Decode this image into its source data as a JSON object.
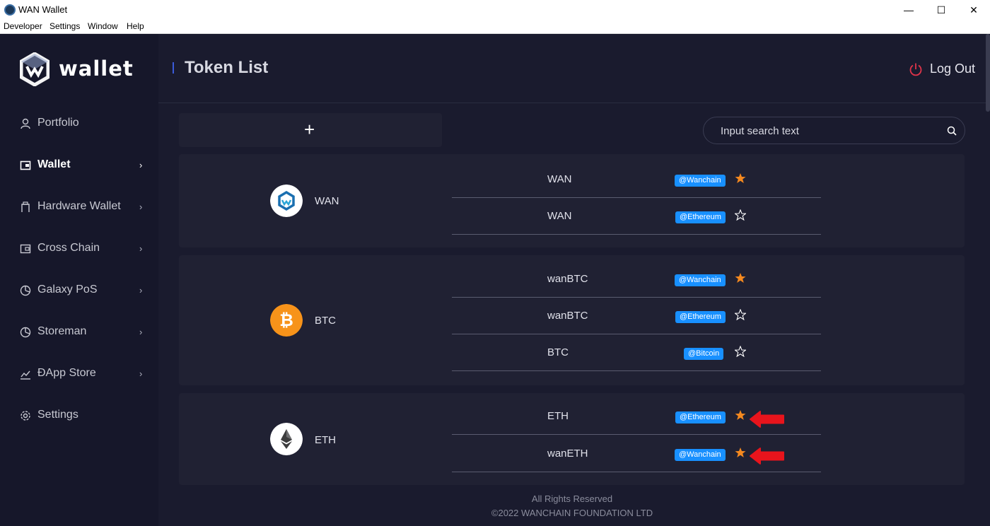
{
  "window": {
    "title": "WAN Wallet",
    "minimize_glyph": "—",
    "maximize_glyph": "☐",
    "close_glyph": "✕"
  },
  "menubar": {
    "items": [
      "Developer",
      "Settings",
      "Window",
      "Help"
    ]
  },
  "sidebar": {
    "logo_text": "wallet",
    "items": [
      {
        "label": "Portfolio",
        "icon": "user-icon",
        "has_chevron": false,
        "active": false
      },
      {
        "label": "Wallet",
        "icon": "wallet-icon",
        "has_chevron": true,
        "active": true
      },
      {
        "label": "Hardware Wallet",
        "icon": "hardware-icon",
        "has_chevron": true,
        "active": false
      },
      {
        "label": "Cross Chain",
        "icon": "cross-chain-icon",
        "has_chevron": true,
        "active": false
      },
      {
        "label": "Galaxy PoS",
        "icon": "pie-chart-icon",
        "has_chevron": true,
        "active": false
      },
      {
        "label": "Storeman",
        "icon": "pie-chart-icon",
        "has_chevron": true,
        "active": false
      },
      {
        "label": "ĐApp Store",
        "icon": "line-chart-icon",
        "has_chevron": true,
        "active": false
      },
      {
        "label": "Settings",
        "icon": "gear-icon",
        "has_chevron": false,
        "active": false
      }
    ],
    "chevron_glyph": "›",
    "collapse_glyph": "‹"
  },
  "header": {
    "title": "Token List",
    "logout_label": "Log Out"
  },
  "toolbar": {
    "add_glyph": "+",
    "search_placeholder": "Input search text"
  },
  "token_groups": [
    {
      "name": "WAN",
      "logo": "wan-logo-icon",
      "tokens": [
        {
          "symbol": "WAN",
          "chain": "@Wanchain",
          "starred": true,
          "arrow": false
        },
        {
          "symbol": "WAN",
          "chain": "@Ethereum",
          "starred": false,
          "arrow": false
        }
      ]
    },
    {
      "name": "BTC",
      "logo": "btc-logo-icon",
      "tokens": [
        {
          "symbol": "wanBTC",
          "chain": "@Wanchain",
          "starred": true,
          "arrow": false
        },
        {
          "symbol": "wanBTC",
          "chain": "@Ethereum",
          "starred": false,
          "arrow": false
        },
        {
          "symbol": "BTC",
          "chain": "@Bitcoin",
          "starred": false,
          "arrow": false
        }
      ]
    },
    {
      "name": "ETH",
      "logo": "eth-logo-icon",
      "tokens": [
        {
          "symbol": "ETH",
          "chain": "@Ethereum",
          "starred": true,
          "arrow": true
        },
        {
          "symbol": "wanETH",
          "chain": "@Wanchain",
          "starred": true,
          "arrow": true
        }
      ]
    }
  ],
  "footer": {
    "line1": "All Rights Reserved",
    "line2": "©2022 WANCHAIN FOUNDATION LTD"
  },
  "colors": {
    "accent_blue": "#1890ff",
    "star_orange": "#f5891f",
    "logout_red": "#e0344a",
    "annotation_red": "#e8141c",
    "btc_orange": "#f7931a"
  }
}
